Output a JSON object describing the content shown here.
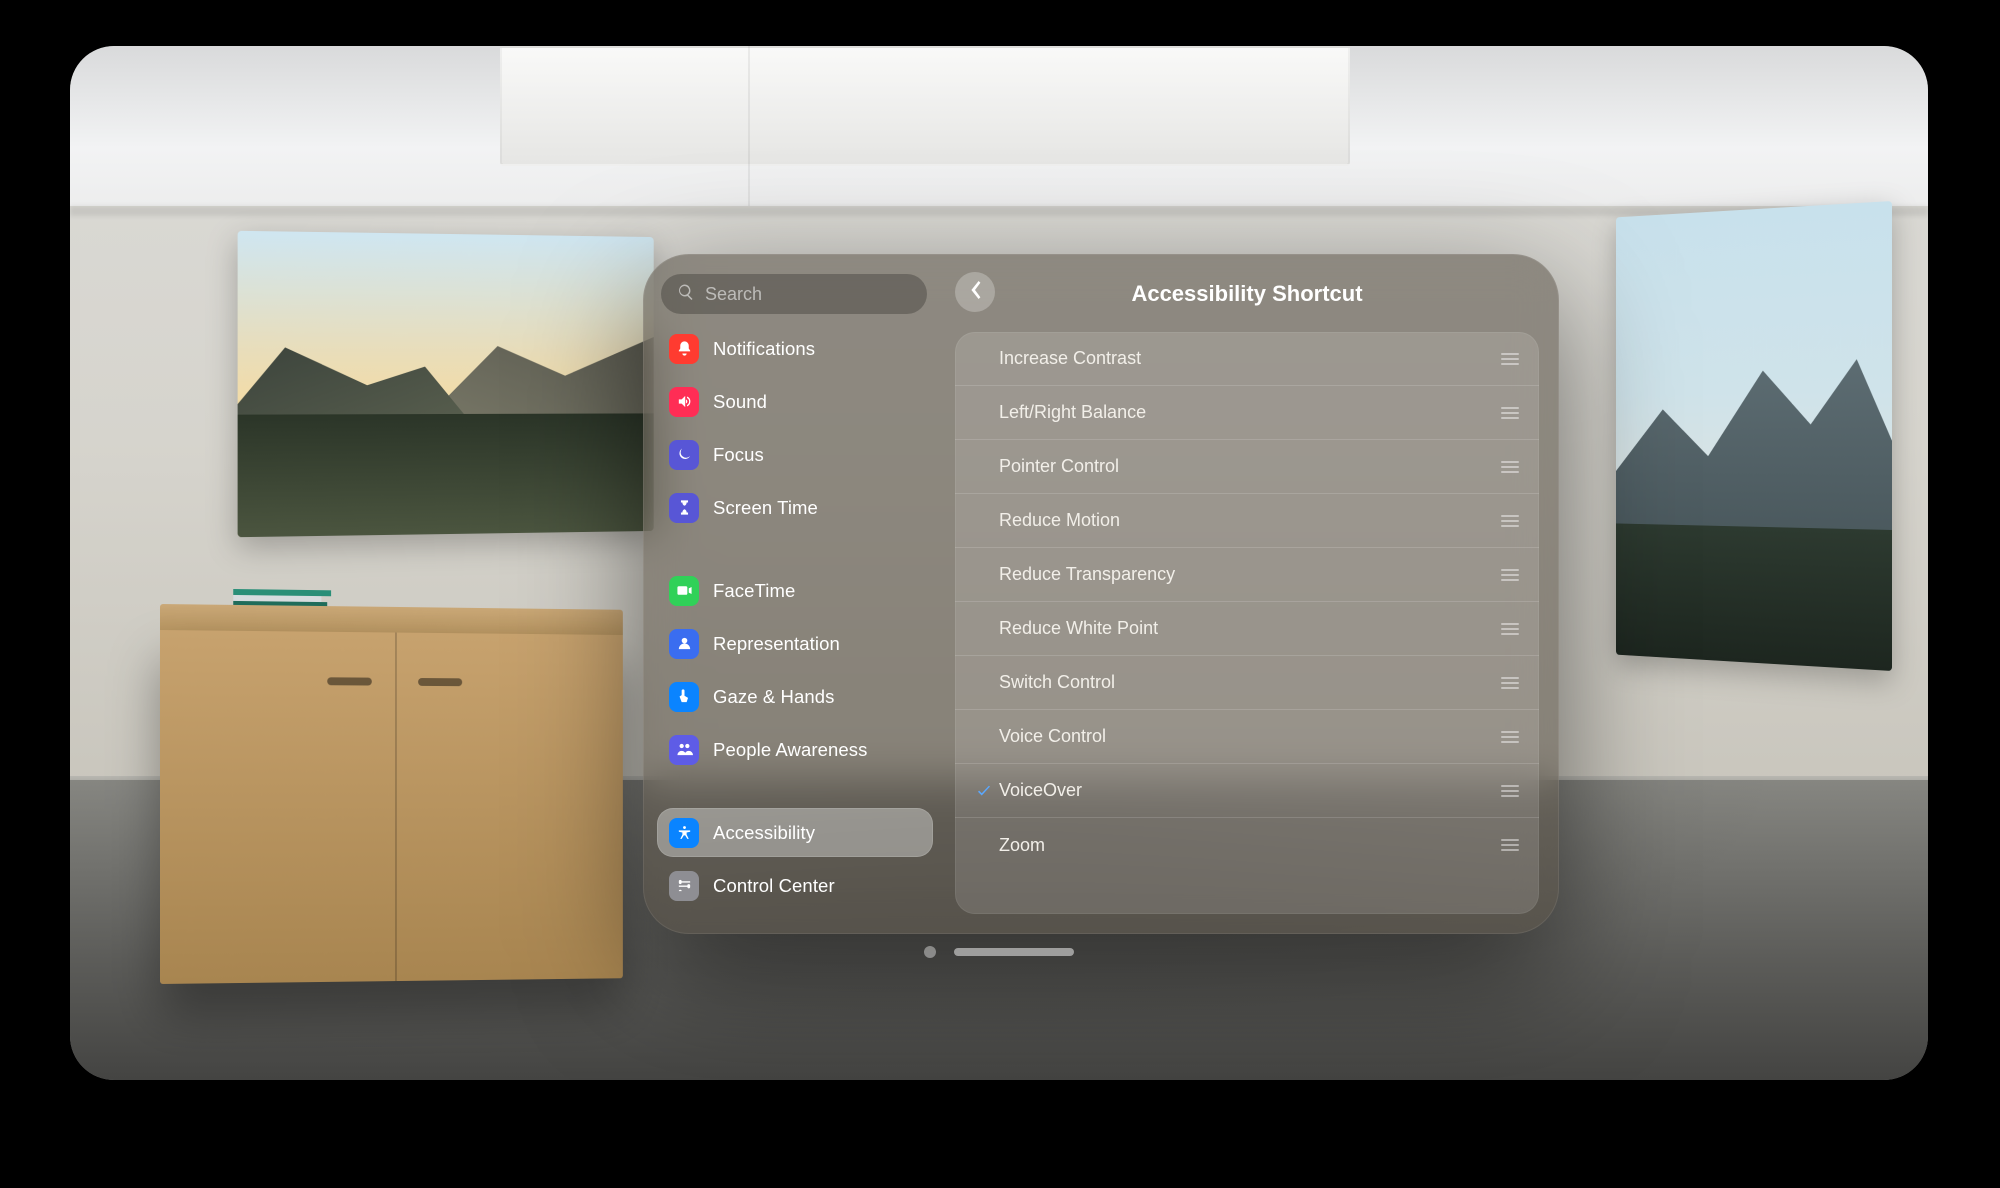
{
  "search": {
    "placeholder": "Search"
  },
  "sidebar": {
    "items": [
      {
        "id": "notifications",
        "label": "Notifications",
        "color": "#ff3b30"
      },
      {
        "id": "sound",
        "label": "Sound",
        "color": "#ff2d55"
      },
      {
        "id": "focus",
        "label": "Focus",
        "color": "#5856d6"
      },
      {
        "id": "screen-time",
        "label": "Screen Time",
        "color": "#5856d6"
      },
      {
        "id": "facetime",
        "label": "FaceTime",
        "color": "#30d158"
      },
      {
        "id": "representation",
        "label": "Representation",
        "color": "#3a6df0"
      },
      {
        "id": "gaze-hands",
        "label": "Gaze & Hands",
        "color": "#0a84ff"
      },
      {
        "id": "people-awareness",
        "label": "People Awareness",
        "color": "#5e5ce6"
      },
      {
        "id": "accessibility",
        "label": "Accessibility",
        "color": "#0a84ff",
        "selected": true
      },
      {
        "id": "control-center",
        "label": "Control Center",
        "color": "#8e8e93"
      }
    ]
  },
  "detail": {
    "title": "Accessibility Shortcut",
    "options": [
      {
        "id": "increase-contrast",
        "label": "Increase Contrast",
        "checked": false
      },
      {
        "id": "left-right-balance",
        "label": "Left/Right Balance",
        "checked": false
      },
      {
        "id": "pointer-control",
        "label": "Pointer Control",
        "checked": false
      },
      {
        "id": "reduce-motion",
        "label": "Reduce Motion",
        "checked": false
      },
      {
        "id": "reduce-transparency",
        "label": "Reduce Transparency",
        "checked": false
      },
      {
        "id": "reduce-white-point",
        "label": "Reduce White Point",
        "checked": false
      },
      {
        "id": "switch-control",
        "label": "Switch Control",
        "checked": false
      },
      {
        "id": "voice-control",
        "label": "Voice Control",
        "checked": false
      },
      {
        "id": "voiceover",
        "label": "VoiceOver",
        "checked": true
      },
      {
        "id": "zoom",
        "label": "Zoom",
        "checked": false
      }
    ]
  }
}
